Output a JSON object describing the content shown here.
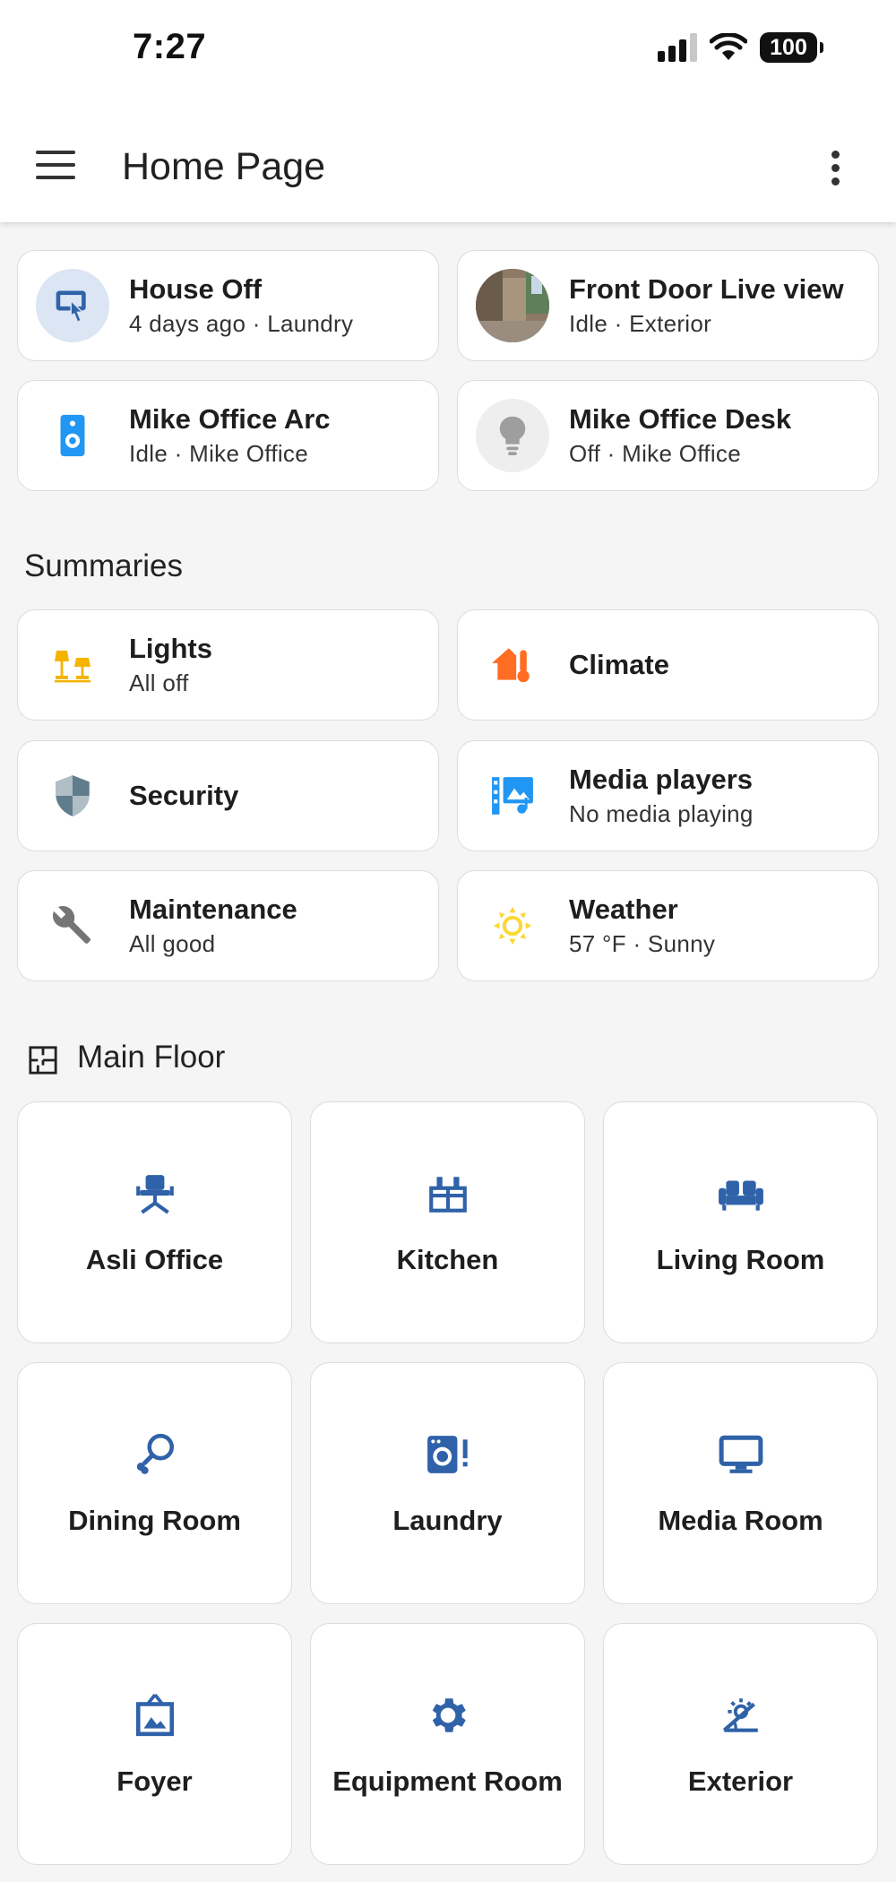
{
  "status_bar": {
    "time": "7:27",
    "battery": "100"
  },
  "app_bar": {
    "title": "Home Page",
    "menu_icon": "hamburger-menu-icon",
    "more_icon": "more-vertical-icon"
  },
  "entities": [
    {
      "name": "House Off",
      "secondary": "4 days ago · Laundry",
      "icon": "gesture-tap-button-icon"
    },
    {
      "name": "Front Door Live view",
      "secondary": "Idle · Exterior",
      "icon": "camera-thumbnail"
    },
    {
      "name": "Mike Office Arc",
      "secondary": "Idle · Mike Office",
      "icon": "speaker-icon"
    },
    {
      "name": "Mike Office Desk",
      "secondary": "Off · Mike Office",
      "icon": "lightbulb-icon"
    }
  ],
  "summaries": {
    "title": "Summaries",
    "items": [
      {
        "name": "Lights",
        "secondary": "All off",
        "icon": "lamps-icon",
        "color": "#f4b400"
      },
      {
        "name": "Climate",
        "secondary": "",
        "icon": "home-thermometer-icon",
        "color": "#ff6d22"
      },
      {
        "name": "Security",
        "secondary": "",
        "icon": "shield-icon",
        "color": "#607d8b"
      },
      {
        "name": "Media players",
        "secondary": "No media playing",
        "icon": "multimedia-icon",
        "color": "#2196f3"
      },
      {
        "name": "Maintenance",
        "secondary": "All good",
        "icon": "wrench-icon",
        "color": "#757575"
      },
      {
        "name": "Weather",
        "secondary": "57 °F · Sunny",
        "icon": "sunny-icon",
        "color": "#fdd835"
      }
    ]
  },
  "floor": {
    "title": "Main Floor",
    "icon": "floor-plan-icon",
    "areas": [
      {
        "name": "Asli Office",
        "icon": "office-chair-icon"
      },
      {
        "name": "Kitchen",
        "icon": "stove-icon"
      },
      {
        "name": "Living Room",
        "icon": "sofa-icon"
      },
      {
        "name": "Dining Room",
        "icon": "food-drumstick-icon"
      },
      {
        "name": "Laundry",
        "icon": "washing-machine-alert-icon"
      },
      {
        "name": "Media Room",
        "icon": "monitor-icon"
      },
      {
        "name": "Foyer",
        "icon": "image-frame-icon"
      },
      {
        "name": "Equipment Room",
        "icon": "cog-icon"
      },
      {
        "name": "Exterior",
        "icon": "sun-angle-icon"
      }
    ]
  },
  "colors": {
    "area_icon": "#2f62a8",
    "background": "#f5f5f5"
  }
}
